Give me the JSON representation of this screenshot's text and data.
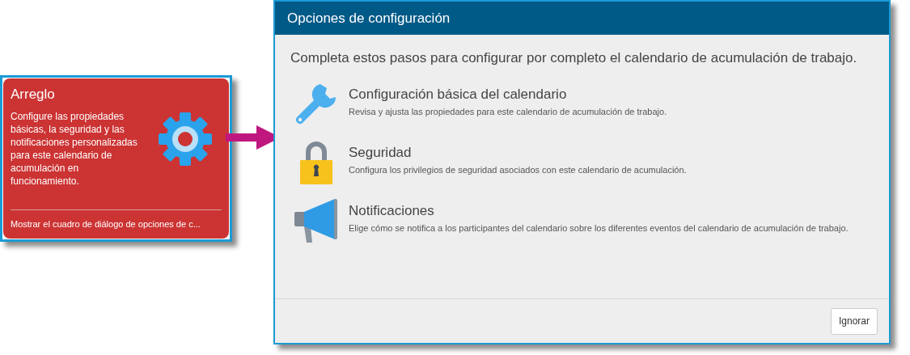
{
  "card": {
    "title": "Arreglo",
    "description": "Configure las propiedades básicas, la seguridad y las notificaciones personalizadas para este calendario de acumulación en funcionamiento.",
    "link": "Mostrar el cuadro de diálogo de opciones de c..."
  },
  "dialog": {
    "title": "Opciones de configuración",
    "intro": "Completa estos pasos para configurar por completo el calendario de acumulación de trabajo.",
    "steps": [
      {
        "kind": "wrench",
        "title": "Configuración básica del calendario",
        "description": "Revisa y ajusta las propiedades para este calendario de acumulación de trabajo."
      },
      {
        "kind": "lock",
        "title": "Seguridad",
        "description": "Configura los privilegios de seguridad asociados con este calendario de acumulación."
      },
      {
        "kind": "megaphone",
        "title": "Notificaciones",
        "description": "Elige cómo se notifica a los participantes del calendario sobre los diferentes eventos del calendario de acumulación de trabajo."
      }
    ],
    "buttons": [
      "Ignorar"
    ]
  }
}
